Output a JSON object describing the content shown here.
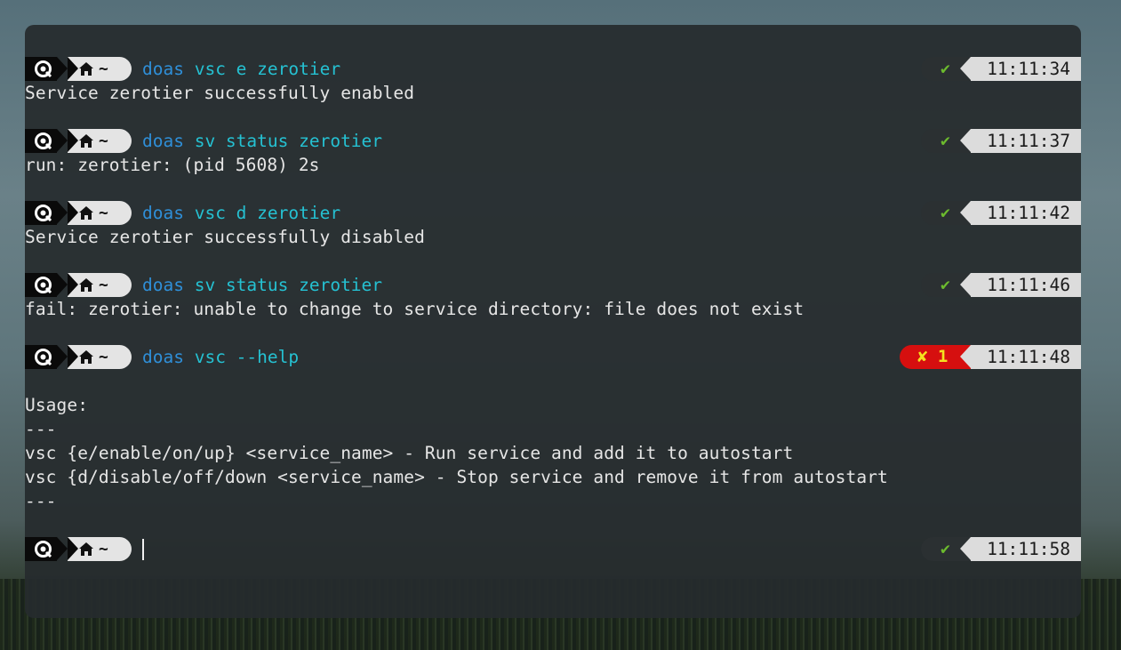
{
  "prompts": [
    {
      "cmd_prefix": "doas",
      "cmd_rest": " vsc e zerotier",
      "status": "✔",
      "time": "11:11:34"
    },
    {
      "cmd_prefix": "doas",
      "cmd_rest": " sv status zerotier",
      "status": "✔",
      "time": "11:11:37"
    },
    {
      "cmd_prefix": "doas",
      "cmd_rest": " vsc d zerotier",
      "status": "✔",
      "time": "11:11:42"
    },
    {
      "cmd_prefix": "doas",
      "cmd_rest": " sv status zerotier",
      "status": "✔",
      "time": "11:11:46"
    },
    {
      "cmd_prefix": "doas",
      "cmd_rest": " vsc --help",
      "status": "✘ 1",
      "time": "11:11:48"
    },
    {
      "cmd_prefix": "",
      "cmd_rest": "",
      "status": "✔",
      "time": "11:11:58"
    }
  ],
  "dir_label": "~",
  "output": [
    "Service zerotier successfully enabled",
    "run: zerotier: (pid 5608) 2s",
    "Service zerotier successfully disabled",
    "fail: zerotier: unable to change to service directory: file does not exist",
    "Usage:",
    "---",
    "vsc {e/enable/on/up} <service_name> - Run service and add it to autostart",
    "vsc {d/disable/off/down <service_name> - Stop service and remove it from autostart",
    "---"
  ],
  "colors": {
    "cmd_prefix": "#2f8fd8",
    "cmd_args": "#25c1d2",
    "ok": "#6cbb2e",
    "error_bg": "#d60f0f",
    "error_fg": "#f4e21f"
  },
  "icons": [
    "os-logo-icon",
    "home-icon",
    "check-icon",
    "cross-icon"
  ]
}
